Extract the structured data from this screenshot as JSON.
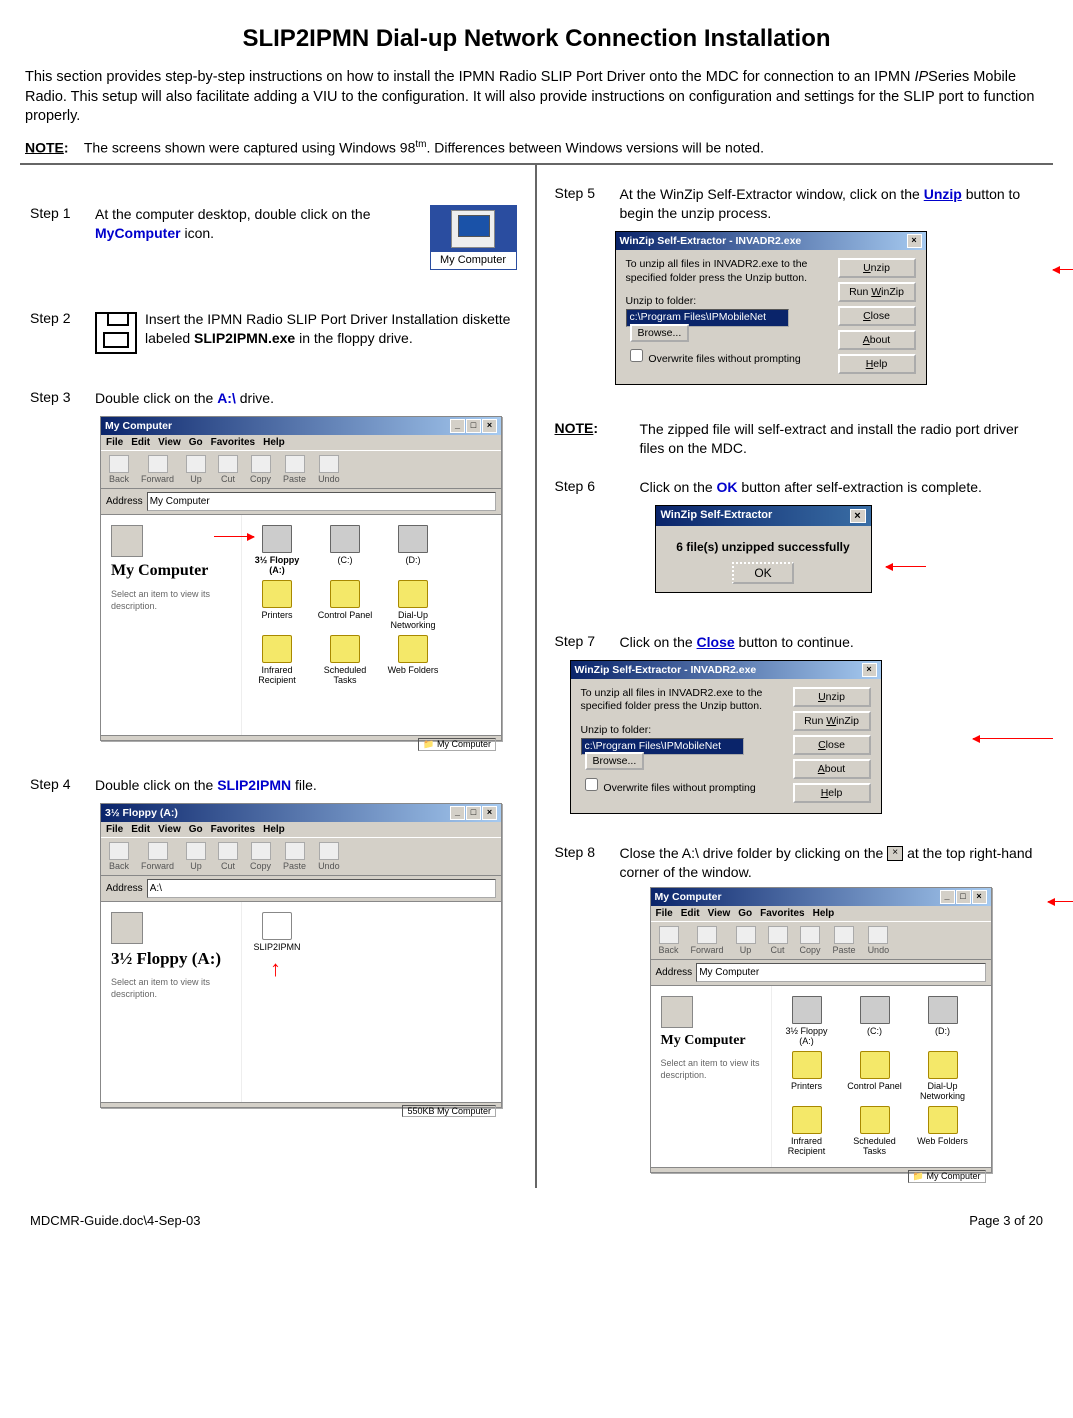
{
  "title": "SLIP2IPMN Dial-up Network Connection Installation",
  "intro": {
    "p1a": "This section provides step-by-step instructions on how to install the IPMN Radio SLIP Port Driver onto the MDC for connection to an IPMN ",
    "ital": "IP",
    "p1b": "Series Mobile Radio.  This setup will also facilitate adding a VIU to the configuration.  It will also provide instructions on configuration and settings for the SLIP port to function properly."
  },
  "note_label": "NOTE",
  "note_colon": ":",
  "note_text_a": "The screens shown were captured using Windows 98",
  "note_tm": "tm",
  "note_text_b": ".  Differences between Windows versions will be noted.",
  "left": {
    "step1": {
      "label": "Step 1",
      "a": "At the computer desktop, double click on the ",
      "link": "MyComputer",
      "b": " icon."
    },
    "mycomputer_label": "My Computer",
    "step2": {
      "label": "Step 2",
      "a": "Insert the IPMN Radio SLIP Port Driver Installation diskette labeled ",
      "bold": "SLIP2IPMN.exe",
      "b": " in the floppy drive."
    },
    "step3": {
      "label": "Step 3",
      "a": "Double click on the ",
      "link": "A:\\",
      "b": " drive."
    },
    "fig3": {
      "title": "My Computer",
      "menus": [
        "File",
        "Edit",
        "View",
        "Go",
        "Favorites",
        "Help"
      ],
      "tools": [
        "Back",
        "Forward",
        "Up",
        "Cut",
        "Copy",
        "Paste",
        "Undo"
      ],
      "address_label": "Address",
      "address_value": "My Computer",
      "side_title": "My Computer",
      "side_sub": "Select an item to view its description.",
      "icons": [
        {
          "label": "3½ Floppy (A:)",
          "bold": true
        },
        {
          "label": "(C:)"
        },
        {
          "label": "(D:)"
        },
        {
          "label": "Printers"
        },
        {
          "label": "Control Panel"
        },
        {
          "label": "Dial-Up Networking"
        },
        {
          "label": "Infrared Recipient"
        },
        {
          "label": "Scheduled Tasks"
        },
        {
          "label": "Web Folders"
        }
      ],
      "status": "My Computer"
    },
    "step4": {
      "label": "Step 4",
      "a": "Double click on the ",
      "link": "SLIP2IPMN",
      "b": " file."
    },
    "fig4": {
      "title": "3½ Floppy (A:)",
      "menus": [
        "File",
        "Edit",
        "View",
        "Go",
        "Favorites",
        "Help"
      ],
      "tools": [
        "Back",
        "Forward",
        "Up",
        "Cut",
        "Copy",
        "Paste",
        "Undo"
      ],
      "address_label": "Address",
      "address_value": "A:\\",
      "side_title": "3½ Floppy (A:)",
      "side_sub": "Select an item to view its description.",
      "file_label": "SLIP2IPMN",
      "status": "550KB   My Computer"
    }
  },
  "right": {
    "step5": {
      "label": "Step 5",
      "a": "At the WinZip Self-Extractor window, click on the ",
      "link": "Unzip",
      "b": " button to begin the unzip process."
    },
    "winzip": {
      "title": "WinZip Self-Extractor - INVADR2.exe",
      "msg": "To unzip all files in INVADR2.exe to the specified folder press the Unzip button.",
      "unzip_to": "Unzip to folder:",
      "path": "c:\\Program Files\\IPMobileNet",
      "browse": "Browse...",
      "overwrite": "Overwrite files without prompting",
      "btns": {
        "unzip": "Unzip",
        "run": "Run WinZip",
        "close": "Close",
        "about": "About",
        "help": "Help"
      }
    },
    "note2_label": "NOTE",
    "note2_text": "The zipped file will self-extract and install the radio port driver files on the MDC.",
    "step6": {
      "label": "Step 6",
      "a": "Click on the ",
      "link": "OK",
      "b": " button after self-extraction is complete."
    },
    "success": {
      "title": "WinZip Self-Extractor",
      "msg": "6 file(s) unzipped successfully",
      "ok": "OK"
    },
    "step7": {
      "label": "Step 7",
      "a": "Click on the ",
      "link": "Close",
      "b": " button to continue."
    },
    "step8": {
      "label": "Step 8",
      "a": "Close the A:\\ drive folder by clicking on the ",
      "b": " at the top right-hand corner of the window."
    },
    "fig8": {
      "title": "My Computer",
      "menus": [
        "File",
        "Edit",
        "View",
        "Go",
        "Favorites",
        "Help"
      ],
      "tools": [
        "Back",
        "Forward",
        "Up",
        "Cut",
        "Copy",
        "Paste",
        "Undo"
      ],
      "address_label": "Address",
      "address_value": "My Computer",
      "side_title": "My Computer",
      "side_sub": "Select an item to view its description.",
      "icons": [
        {
          "label": "3½ Floppy (A:)"
        },
        {
          "label": "(C:)"
        },
        {
          "label": "(D:)"
        },
        {
          "label": "Printers"
        },
        {
          "label": "Control Panel"
        },
        {
          "label": "Dial-Up Networking"
        },
        {
          "label": "Infrared Recipient"
        },
        {
          "label": "Scheduled Tasks"
        },
        {
          "label": "Web Folders"
        }
      ],
      "status": "My Computer"
    }
  },
  "footer": {
    "left": "MDCMR-Guide.doc\\4-Sep-03",
    "right": "Page 3 of 20"
  }
}
